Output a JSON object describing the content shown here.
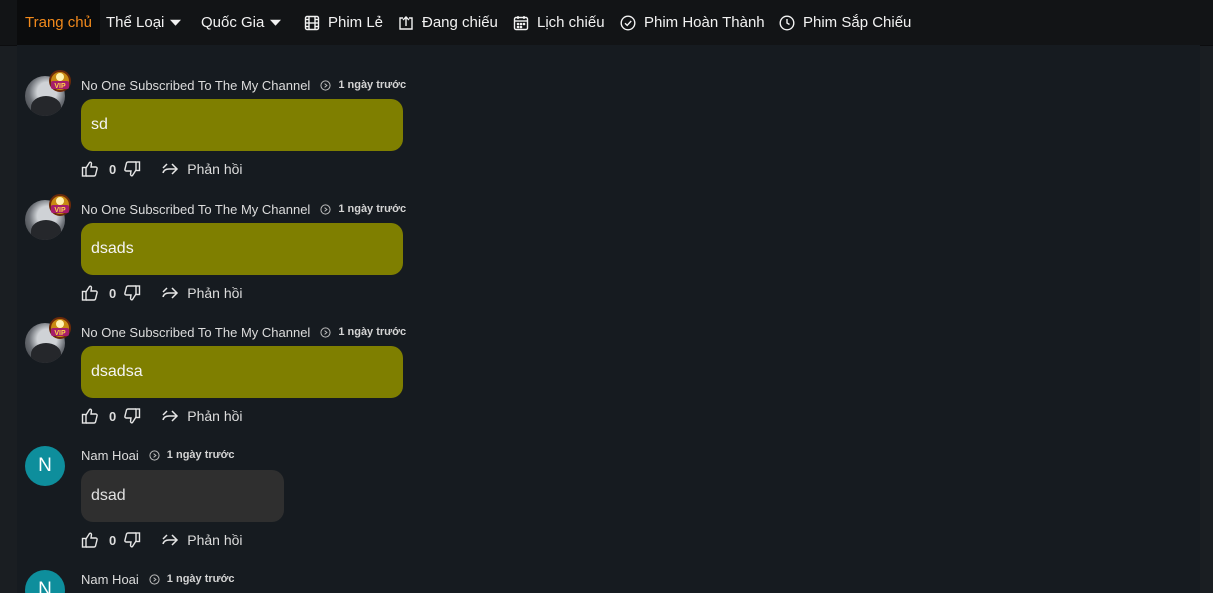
{
  "nav": {
    "home": "Trang chủ",
    "genre": "Thể Loại",
    "country": "Quốc Gia",
    "single": "Phim Lẻ",
    "showing": "Đang chiếu",
    "schedule": "Lịch chiếu",
    "completed": "Phim Hoàn Thành",
    "upcoming": "Phim Sắp Chiếu"
  },
  "comments": [
    {
      "user": "No One Subscribed To The My Channel",
      "time": "1 ngày trước",
      "text": "sd",
      "likes": "0",
      "reply": "Phản hồi",
      "vip": true
    },
    {
      "user": "No One Subscribed To The My Channel",
      "time": "1 ngày trước",
      "text": "dsads",
      "likes": "0",
      "reply": "Phản hồi",
      "vip": true
    },
    {
      "user": "No One Subscribed To The My Channel",
      "time": "1 ngày trước",
      "text": "dsadsa",
      "likes": "0",
      "reply": "Phản hồi",
      "vip": true
    },
    {
      "user": "Nam Hoai",
      "initial": "N",
      "time": "1 ngày trước",
      "text": "dsad",
      "likes": "0",
      "reply": "Phản hồi",
      "vip": false
    },
    {
      "user": "Nam Hoai",
      "initial": "N",
      "time": "1 ngày trước",
      "vip": false
    }
  ],
  "colors": {
    "accent": "#f28a1c",
    "vip_bubble": "#7f7f00",
    "normal_bubble": "#2f2f2f",
    "avatar_teal": "#0e8e9c"
  }
}
